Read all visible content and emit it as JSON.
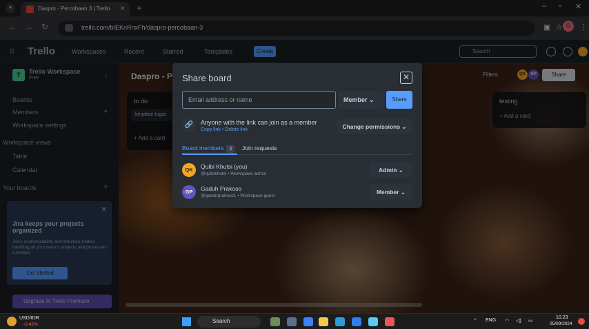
{
  "browser": {
    "tab_title": "Daspro - Percobaan 3 | Trello",
    "url": "trello.com/b/EKnRnxFh/daspro-percobaan-3",
    "profile_initial": "G"
  },
  "trello_header": {
    "logo": "Trello",
    "nav": [
      "Workspaces",
      "Recent",
      "Starred",
      "Templates"
    ],
    "create_label": "Create",
    "search_placeholder": "Search"
  },
  "sidebar": {
    "workspace_badge": "T",
    "workspace_name": "Trello Workspace",
    "workspace_plan": "Free",
    "items": [
      "Boards",
      "Members",
      "Workspace settings"
    ],
    "views_heading": "Workspace views",
    "views": [
      "Table",
      "Calendar"
    ],
    "boards_heading": "Your boards",
    "promo": {
      "title": "Jira keeps your projects organized",
      "body": "Jira's customizability and structure makes handling all your team's projects and processes a breeze.",
      "cta": "Get started"
    },
    "upgrade_label": "Upgrade to Trello Premium"
  },
  "board": {
    "title": "Daspro - Pe",
    "filters_label": "Filters",
    "share_label": "Share",
    "member_avatars": [
      "QK",
      "GP"
    ],
    "lists": [
      {
        "title": "to do",
        "cards": [
          "kerjakan tugas"
        ],
        "add_label": "+ Add a card"
      },
      {
        "title": "testing",
        "cards": [],
        "add_label": "+ Add a card"
      }
    ]
  },
  "modal": {
    "title": "Share board",
    "email_placeholder": "Email address or name",
    "role_selected": "Member",
    "share_button": "Share",
    "link_text": "Anyone with the link can join as a member",
    "copy_link": "Copy link",
    "delete_link": "Delete link",
    "link_separator": "•",
    "change_permissions": "Change permissions",
    "tabs": {
      "members_label": "Board members",
      "members_count": "2",
      "join_label": "Join requests"
    },
    "members": [
      {
        "initials": "QK",
        "name": "Qulbi Khutsi (you)",
        "meta": "@qulbikhutsi • Workspace admin",
        "role": "Admin",
        "avatar_color": "#f5a623",
        "avatar_text_color": "#1d2125"
      },
      {
        "initials": "GP",
        "name": "Gaduh Prakoso",
        "meta": "@gaduhprakoso1 • Workspace guest",
        "role": "Member",
        "avatar_color": "#6554c0",
        "avatar_text_color": "#ffffff"
      }
    ]
  },
  "taskbar": {
    "ticker": "USD/IDR",
    "ticker_change": "-0.42%",
    "search_label": "Search",
    "language": "ENG",
    "time": "10.23",
    "date": "05/09/2024"
  },
  "colors": {
    "accent": "#579dff",
    "modal_bg": "#282e33",
    "header_bg": "#1d2125"
  }
}
